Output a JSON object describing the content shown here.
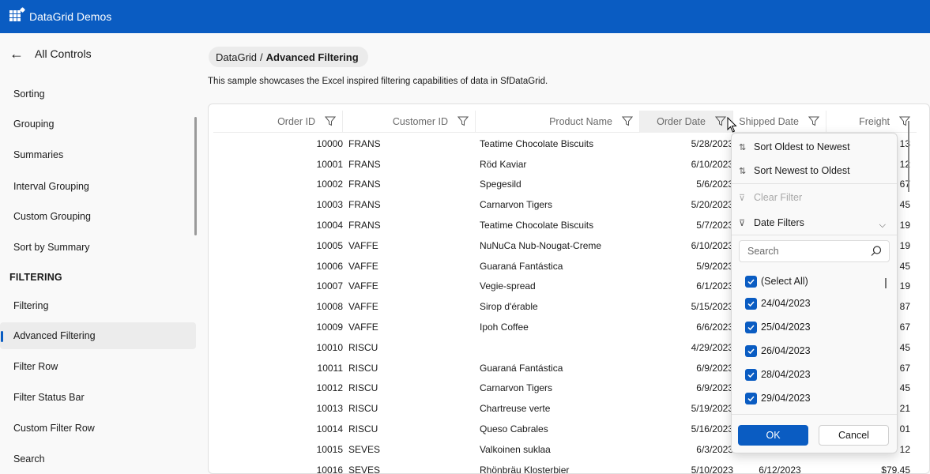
{
  "app": {
    "title": "DataGrid Demos"
  },
  "sidebar": {
    "back_label": "All Controls",
    "items_top": [
      {
        "label": "Sorting"
      },
      {
        "label": "Grouping"
      },
      {
        "label": "Summaries"
      },
      {
        "label": "Interval Grouping"
      },
      {
        "label": "Custom Grouping"
      },
      {
        "label": "Sort by Summary"
      }
    ],
    "section_label": "FILTERING",
    "items_filtering": [
      {
        "label": "Filtering"
      },
      {
        "label": "Advanced Filtering",
        "selected": true
      },
      {
        "label": "Filter Row"
      },
      {
        "label": "Filter Status Bar"
      },
      {
        "label": "Custom Filter Row"
      },
      {
        "label": "Search"
      }
    ]
  },
  "breadcrumb": {
    "root": "DataGrid",
    "separator": "/",
    "current": "Advanced Filtering"
  },
  "description": "This sample showcases the Excel inspired filtering capabilities of data in SfDataGrid.",
  "grid": {
    "columns": [
      "Order ID",
      "Customer ID",
      "Product Name",
      "Order Date",
      "Shipped Date",
      "Freight"
    ],
    "rows": [
      {
        "id": "10000",
        "cust": "FRANS",
        "prod": "Teatime Chocolate Biscuits",
        "odate": "5/28/2023",
        "sdate": "",
        "freight": "13"
      },
      {
        "id": "10001",
        "cust": "FRANS",
        "prod": "Röd Kaviar",
        "odate": "6/10/2023",
        "sdate": "",
        "freight": "12"
      },
      {
        "id": "10002",
        "cust": "FRANS",
        "prod": "Spegesild",
        "odate": "5/6/2023",
        "sdate": "",
        "freight": "67"
      },
      {
        "id": "10003",
        "cust": "FRANS",
        "prod": "Carnarvon Tigers",
        "odate": "5/20/2023",
        "sdate": "",
        "freight": "45"
      },
      {
        "id": "10004",
        "cust": "FRANS",
        "prod": "Teatime Chocolate Biscuits",
        "odate": "5/7/2023",
        "sdate": "",
        "freight": "19"
      },
      {
        "id": "10005",
        "cust": "VAFFE",
        "prod": "NuNuCa Nub-Nougat-Creme",
        "odate": "6/10/2023",
        "sdate": "",
        "freight": "19"
      },
      {
        "id": "10006",
        "cust": "VAFFE",
        "prod": "Guaraná Fantástica",
        "odate": "5/9/2023",
        "sdate": "",
        "freight": "45"
      },
      {
        "id": "10007",
        "cust": "VAFFE",
        "prod": "Vegie-spread",
        "odate": "6/1/2023",
        "sdate": "",
        "freight": "19"
      },
      {
        "id": "10008",
        "cust": "VAFFE",
        "prod": "Sirop d'érable",
        "odate": "5/15/2023",
        "sdate": "",
        "freight": "87"
      },
      {
        "id": "10009",
        "cust": "VAFFE",
        "prod": "Ipoh Coffee",
        "odate": "6/6/2023",
        "sdate": "",
        "freight": "67"
      },
      {
        "id": "10010",
        "cust": "RISCU",
        "prod": "",
        "odate": "4/29/2023",
        "sdate": "",
        "freight": "45"
      },
      {
        "id": "10011",
        "cust": "RISCU",
        "prod": "Guaraná Fantástica",
        "odate": "6/9/2023",
        "sdate": "",
        "freight": "67"
      },
      {
        "id": "10012",
        "cust": "RISCU",
        "prod": "Carnarvon Tigers",
        "odate": "6/9/2023",
        "sdate": "",
        "freight": "45"
      },
      {
        "id": "10013",
        "cust": "RISCU",
        "prod": "Chartreuse verte",
        "odate": "5/19/2023",
        "sdate": "",
        "freight": "21"
      },
      {
        "id": "10014",
        "cust": "RISCU",
        "prod": "Queso Cabrales",
        "odate": "5/16/2023",
        "sdate": "",
        "freight": "01"
      },
      {
        "id": "10015",
        "cust": "SEVES",
        "prod": "Valkoinen suklaa",
        "odate": "6/3/2023",
        "sdate": "",
        "freight": "12"
      },
      {
        "id": "10016",
        "cust": "SEVES",
        "prod": "Rhönbräu Klosterbier",
        "odate": "5/10/2023",
        "sdate": "6/12/2023",
        "freight": "$79.45"
      }
    ]
  },
  "filter_popup": {
    "sort_asc": "Sort Oldest to Newest",
    "sort_desc": "Sort Newest to Oldest",
    "clear_filter": "Clear Filter",
    "date_filters": "Date Filters",
    "search_placeholder": "Search",
    "items": [
      {
        "label": "(Select All)",
        "checked": true
      },
      {
        "label": "24/04/2023",
        "checked": true
      },
      {
        "label": "25/04/2023",
        "checked": true
      },
      {
        "label": "26/04/2023",
        "checked": true
      },
      {
        "label": "28/04/2023",
        "checked": true
      },
      {
        "label": "29/04/2023",
        "checked": true
      }
    ],
    "ok_label": "OK",
    "cancel_label": "Cancel"
  },
  "colors": {
    "accent": "#0a5cc2",
    "titlebar": "#0a5cc2"
  }
}
